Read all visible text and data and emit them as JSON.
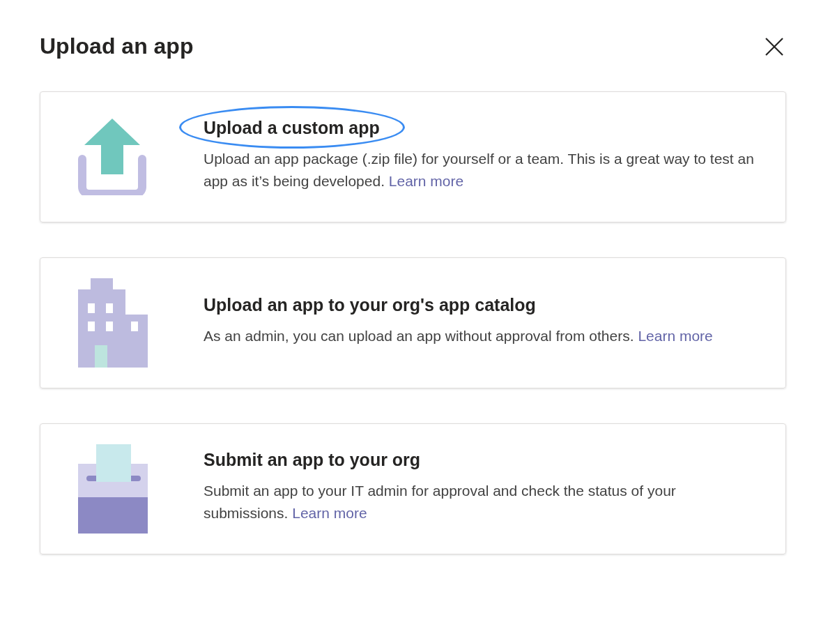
{
  "dialog": {
    "title": "Upload an app"
  },
  "options": [
    {
      "kind": "upload",
      "title": "Upload a custom app",
      "highlighted": true,
      "description": "Upload an app package (.zip file) for yourself or a team. This is a great way to test an app as it’s being developed.",
      "link": "Learn more"
    },
    {
      "kind": "catalog",
      "title": "Upload an app to your org's app catalog",
      "highlighted": false,
      "description": "As an admin, you can upload an app without approval from others.",
      "link": "Learn more"
    },
    {
      "kind": "submit",
      "title": "Submit an app to your org",
      "highlighted": false,
      "description": "Submit an app to your IT admin for approval and check the status of your submissions.",
      "link": "Learn more"
    }
  ]
}
